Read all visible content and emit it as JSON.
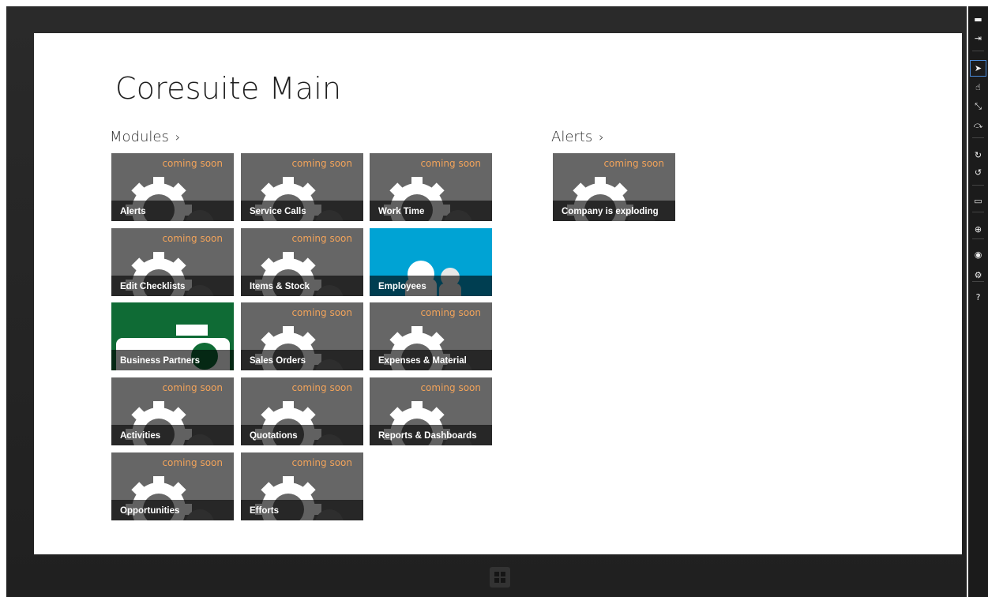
{
  "page": {
    "title": "Coresuite Main"
  },
  "sections": {
    "modules": {
      "title": "Modules",
      "chevron": "›"
    },
    "alerts": {
      "title": "Alerts",
      "chevron": "›"
    }
  },
  "tiles": {
    "t0": {
      "label": "Alerts",
      "badge": "coming soon"
    },
    "t1": {
      "label": "Service Calls",
      "badge": "coming soon"
    },
    "t2": {
      "label": "Work Time",
      "badge": "coming soon"
    },
    "t3": {
      "label": "Edit Checklists",
      "badge": "coming soon"
    },
    "t4": {
      "label": "Items & Stock",
      "badge": "coming soon"
    },
    "t5": {
      "label": "Employees",
      "color": "#00a3d4"
    },
    "t6": {
      "label": "Business Partners",
      "color": "#0f6b35"
    },
    "t7": {
      "label": "Sales Orders",
      "badge": "coming soon"
    },
    "t8": {
      "label": "Expenses & Material",
      "badge": "coming soon"
    },
    "t9": {
      "label": "Activities",
      "badge": "coming soon"
    },
    "t10": {
      "label": "Quotations",
      "badge": "coming soon"
    },
    "t11": {
      "label": "Reports & Dashboards",
      "badge": "coming soon"
    },
    "t12": {
      "label": "Opportunities",
      "badge": "coming soon"
    },
    "t13": {
      "label": "Efforts",
      "badge": "coming soon"
    },
    "a0": {
      "label": "Company is exploding",
      "badge": "coming soon"
    }
  },
  "simulator_toolbar": [
    {
      "icon": "minimize-icon",
      "glyph": "▬"
    },
    {
      "icon": "pin-icon",
      "glyph": "⇥"
    },
    {
      "icon": "pointer-mode-icon",
      "glyph": "➤",
      "active": true
    },
    {
      "icon": "touch-mode-icon",
      "glyph": "☝"
    },
    {
      "icon": "pinch-zoom-icon",
      "glyph": "⤡"
    },
    {
      "icon": "rotate-touch-icon",
      "glyph": "⤼"
    },
    {
      "icon": "rotate-clockwise-icon",
      "glyph": "↻"
    },
    {
      "icon": "rotate-counterclockwise-icon",
      "glyph": "↺"
    },
    {
      "icon": "resolution-icon",
      "glyph": "▭"
    },
    {
      "icon": "location-icon",
      "glyph": "⊕"
    },
    {
      "icon": "screenshot-icon",
      "glyph": "◉"
    },
    {
      "icon": "settings-icon",
      "glyph": "⚙"
    },
    {
      "icon": "help-icon",
      "glyph": "?"
    }
  ],
  "colors": {
    "tile_gray": "#666666",
    "coming_soon": "#f2a35a",
    "employees": "#00a3d4",
    "business_partners": "#0f6b35"
  }
}
